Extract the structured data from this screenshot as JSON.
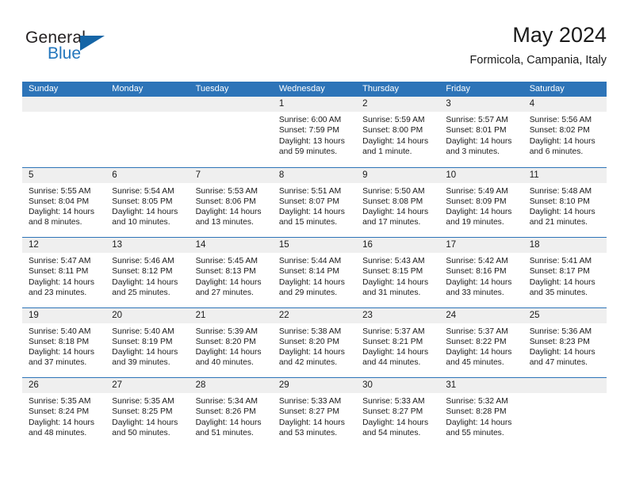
{
  "logo": {
    "word_top": "General",
    "word_bottom": "Blue",
    "accent_color": "#2276bd",
    "triangle_color": "#1565a6",
    "triangle_icon": "triangle-icon"
  },
  "header": {
    "title": "May 2024",
    "subtitle": "Formicola, Campania, Italy"
  },
  "theme": {
    "header_blue": "#2d74b8",
    "day_band_gray": "#efefef",
    "text": "#1a1a1a"
  },
  "weekdays": [
    "Sunday",
    "Monday",
    "Tuesday",
    "Wednesday",
    "Thursday",
    "Friday",
    "Saturday"
  ],
  "weeks": [
    [
      {
        "day": "",
        "lines": [
          "",
          "",
          "",
          ""
        ]
      },
      {
        "day": "",
        "lines": [
          "",
          "",
          "",
          ""
        ]
      },
      {
        "day": "",
        "lines": [
          "",
          "",
          "",
          ""
        ]
      },
      {
        "day": "1",
        "lines": [
          "Sunrise: 6:00 AM",
          "Sunset: 7:59 PM",
          "Daylight: 13 hours",
          "and 59 minutes."
        ]
      },
      {
        "day": "2",
        "lines": [
          "Sunrise: 5:59 AM",
          "Sunset: 8:00 PM",
          "Daylight: 14 hours",
          "and 1 minute."
        ]
      },
      {
        "day": "3",
        "lines": [
          "Sunrise: 5:57 AM",
          "Sunset: 8:01 PM",
          "Daylight: 14 hours",
          "and 3 minutes."
        ]
      },
      {
        "day": "4",
        "lines": [
          "Sunrise: 5:56 AM",
          "Sunset: 8:02 PM",
          "Daylight: 14 hours",
          "and 6 minutes."
        ]
      }
    ],
    [
      {
        "day": "5",
        "lines": [
          "Sunrise: 5:55 AM",
          "Sunset: 8:04 PM",
          "Daylight: 14 hours",
          "and 8 minutes."
        ]
      },
      {
        "day": "6",
        "lines": [
          "Sunrise: 5:54 AM",
          "Sunset: 8:05 PM",
          "Daylight: 14 hours",
          "and 10 minutes."
        ]
      },
      {
        "day": "7",
        "lines": [
          "Sunrise: 5:53 AM",
          "Sunset: 8:06 PM",
          "Daylight: 14 hours",
          "and 13 minutes."
        ]
      },
      {
        "day": "8",
        "lines": [
          "Sunrise: 5:51 AM",
          "Sunset: 8:07 PM",
          "Daylight: 14 hours",
          "and 15 minutes."
        ]
      },
      {
        "day": "9",
        "lines": [
          "Sunrise: 5:50 AM",
          "Sunset: 8:08 PM",
          "Daylight: 14 hours",
          "and 17 minutes."
        ]
      },
      {
        "day": "10",
        "lines": [
          "Sunrise: 5:49 AM",
          "Sunset: 8:09 PM",
          "Daylight: 14 hours",
          "and 19 minutes."
        ]
      },
      {
        "day": "11",
        "lines": [
          "Sunrise: 5:48 AM",
          "Sunset: 8:10 PM",
          "Daylight: 14 hours",
          "and 21 minutes."
        ]
      }
    ],
    [
      {
        "day": "12",
        "lines": [
          "Sunrise: 5:47 AM",
          "Sunset: 8:11 PM",
          "Daylight: 14 hours",
          "and 23 minutes."
        ]
      },
      {
        "day": "13",
        "lines": [
          "Sunrise: 5:46 AM",
          "Sunset: 8:12 PM",
          "Daylight: 14 hours",
          "and 25 minutes."
        ]
      },
      {
        "day": "14",
        "lines": [
          "Sunrise: 5:45 AM",
          "Sunset: 8:13 PM",
          "Daylight: 14 hours",
          "and 27 minutes."
        ]
      },
      {
        "day": "15",
        "lines": [
          "Sunrise: 5:44 AM",
          "Sunset: 8:14 PM",
          "Daylight: 14 hours",
          "and 29 minutes."
        ]
      },
      {
        "day": "16",
        "lines": [
          "Sunrise: 5:43 AM",
          "Sunset: 8:15 PM",
          "Daylight: 14 hours",
          "and 31 minutes."
        ]
      },
      {
        "day": "17",
        "lines": [
          "Sunrise: 5:42 AM",
          "Sunset: 8:16 PM",
          "Daylight: 14 hours",
          "and 33 minutes."
        ]
      },
      {
        "day": "18",
        "lines": [
          "Sunrise: 5:41 AM",
          "Sunset: 8:17 PM",
          "Daylight: 14 hours",
          "and 35 minutes."
        ]
      }
    ],
    [
      {
        "day": "19",
        "lines": [
          "Sunrise: 5:40 AM",
          "Sunset: 8:18 PM",
          "Daylight: 14 hours",
          "and 37 minutes."
        ]
      },
      {
        "day": "20",
        "lines": [
          "Sunrise: 5:40 AM",
          "Sunset: 8:19 PM",
          "Daylight: 14 hours",
          "and 39 minutes."
        ]
      },
      {
        "day": "21",
        "lines": [
          "Sunrise: 5:39 AM",
          "Sunset: 8:20 PM",
          "Daylight: 14 hours",
          "and 40 minutes."
        ]
      },
      {
        "day": "22",
        "lines": [
          "Sunrise: 5:38 AM",
          "Sunset: 8:20 PM",
          "Daylight: 14 hours",
          "and 42 minutes."
        ]
      },
      {
        "day": "23",
        "lines": [
          "Sunrise: 5:37 AM",
          "Sunset: 8:21 PM",
          "Daylight: 14 hours",
          "and 44 minutes."
        ]
      },
      {
        "day": "24",
        "lines": [
          "Sunrise: 5:37 AM",
          "Sunset: 8:22 PM",
          "Daylight: 14 hours",
          "and 45 minutes."
        ]
      },
      {
        "day": "25",
        "lines": [
          "Sunrise: 5:36 AM",
          "Sunset: 8:23 PM",
          "Daylight: 14 hours",
          "and 47 minutes."
        ]
      }
    ],
    [
      {
        "day": "26",
        "lines": [
          "Sunrise: 5:35 AM",
          "Sunset: 8:24 PM",
          "Daylight: 14 hours",
          "and 48 minutes."
        ]
      },
      {
        "day": "27",
        "lines": [
          "Sunrise: 5:35 AM",
          "Sunset: 8:25 PM",
          "Daylight: 14 hours",
          "and 50 minutes."
        ]
      },
      {
        "day": "28",
        "lines": [
          "Sunrise: 5:34 AM",
          "Sunset: 8:26 PM",
          "Daylight: 14 hours",
          "and 51 minutes."
        ]
      },
      {
        "day": "29",
        "lines": [
          "Sunrise: 5:33 AM",
          "Sunset: 8:27 PM",
          "Daylight: 14 hours",
          "and 53 minutes."
        ]
      },
      {
        "day": "30",
        "lines": [
          "Sunrise: 5:33 AM",
          "Sunset: 8:27 PM",
          "Daylight: 14 hours",
          "and 54 minutes."
        ]
      },
      {
        "day": "31",
        "lines": [
          "Sunrise: 5:32 AM",
          "Sunset: 8:28 PM",
          "Daylight: 14 hours",
          "and 55 minutes."
        ]
      },
      {
        "day": "",
        "lines": [
          "",
          "",
          "",
          ""
        ]
      }
    ]
  ]
}
